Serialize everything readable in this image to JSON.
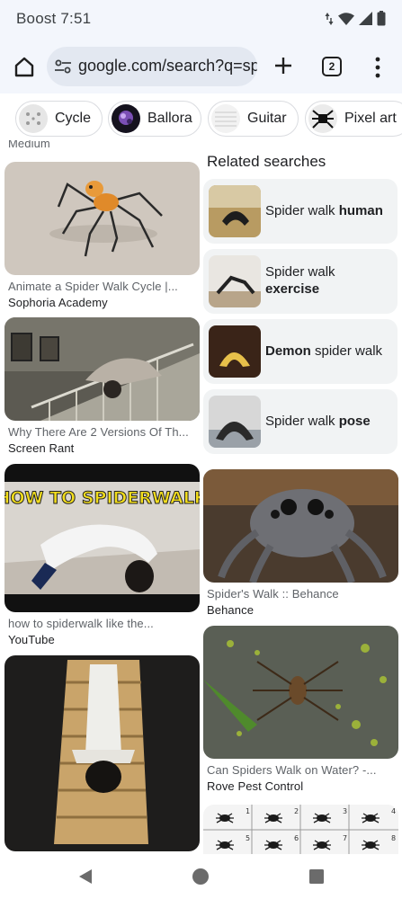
{
  "status": {
    "carrier_time": "Boost 7:51"
  },
  "toolbar": {
    "url": "google.com/search?q=sp",
    "tab_count": "2"
  },
  "chips": [
    {
      "label": "Cycle"
    },
    {
      "label": "Ballora"
    },
    {
      "label": "Guitar"
    },
    {
      "label": "Pixel art"
    }
  ],
  "results": {
    "top_partial": "Medium",
    "left": [
      {
        "title": "Animate a Spider Walk Cycle |...",
        "source": "Sophoria Academy"
      },
      {
        "title": "Why There Are 2 Versions Of Th...",
        "source": "Screen Rant"
      },
      {
        "title": "how to spiderwalk like the...",
        "source": "YouTube",
        "overlay_text": "HOW TO SPIDERWALK"
      },
      {
        "title": "",
        "source": ""
      }
    ],
    "right": [
      {
        "title": "Spider's Walk :: Behance",
        "source": "Behance"
      },
      {
        "title": "Can Spiders Walk on Water? -...",
        "source": "Rove Pest Control"
      }
    ]
  },
  "related": {
    "heading": "Related searches",
    "items": [
      {
        "pre": "Spider walk ",
        "bold": "human",
        "post": ""
      },
      {
        "pre": "Spider walk ",
        "bold": "exercise",
        "post": ""
      },
      {
        "pre": "",
        "bold": "Demon",
        "post": " spider walk"
      },
      {
        "pre": "Spider walk ",
        "bold": "pose",
        "post": ""
      }
    ]
  },
  "sprite_numbers": [
    "1",
    "2",
    "3",
    "4",
    "5",
    "6",
    "7",
    "8"
  ],
  "colors": {
    "chrome_bg": "#f3f6fc",
    "omnibox_bg": "#e3e8f1",
    "related_bg": "#f1f3f4"
  }
}
